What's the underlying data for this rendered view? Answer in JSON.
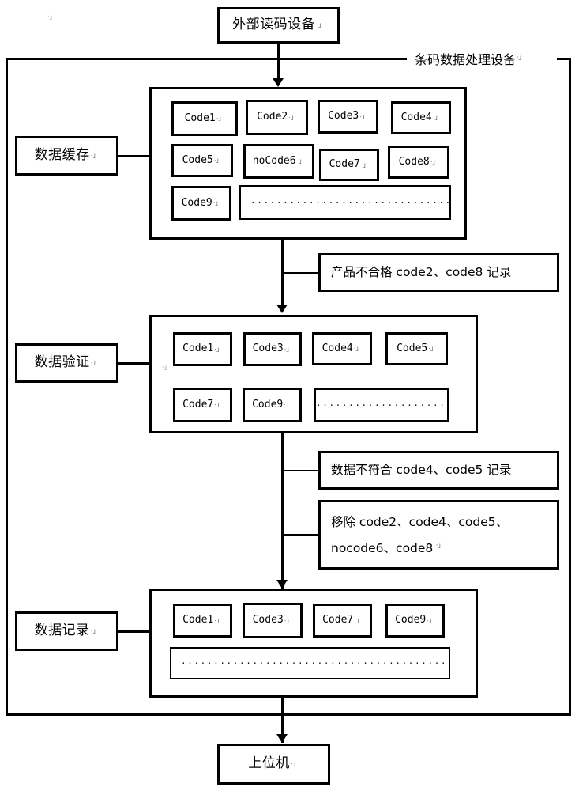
{
  "diagram": {
    "title_note": "条码数据处理设备",
    "stray_mark": "·↓"
  },
  "external": {
    "label": "外部读码设备"
  },
  "host": {
    "label": "上位机"
  },
  "stage_labels": {
    "buffer": "数据缓存",
    "validate": "数据验证",
    "record": "数据记录"
  },
  "buffer_stage": {
    "row1": [
      "Code1",
      "Code2",
      "Code3",
      "Code4"
    ],
    "row2": [
      "Code5",
      "noCode6",
      "Code7",
      "Code8"
    ],
    "row3": [
      "Code9"
    ],
    "ellipsis": "····································································"
  },
  "validate_stage": {
    "row1": [
      "Code1",
      "Code3",
      "Code4",
      "Code5"
    ],
    "row2": [
      "Code7",
      "Code9"
    ],
    "ellipsis": "······································"
  },
  "record_stage": {
    "row1": [
      "Code1",
      "Code3",
      "Code7",
      "Code9"
    ],
    "ellipsis": "···················································································"
  },
  "annotations": {
    "reject": "产品不合格 code2、code8 记录",
    "mismatch": "数据不符合 code4、code5 记录",
    "remove_line1": "移除 code2、code4、code5、",
    "remove_line2": "nocode6、code8"
  },
  "colors": {
    "stroke": "#000000",
    "background": "#ffffff"
  }
}
